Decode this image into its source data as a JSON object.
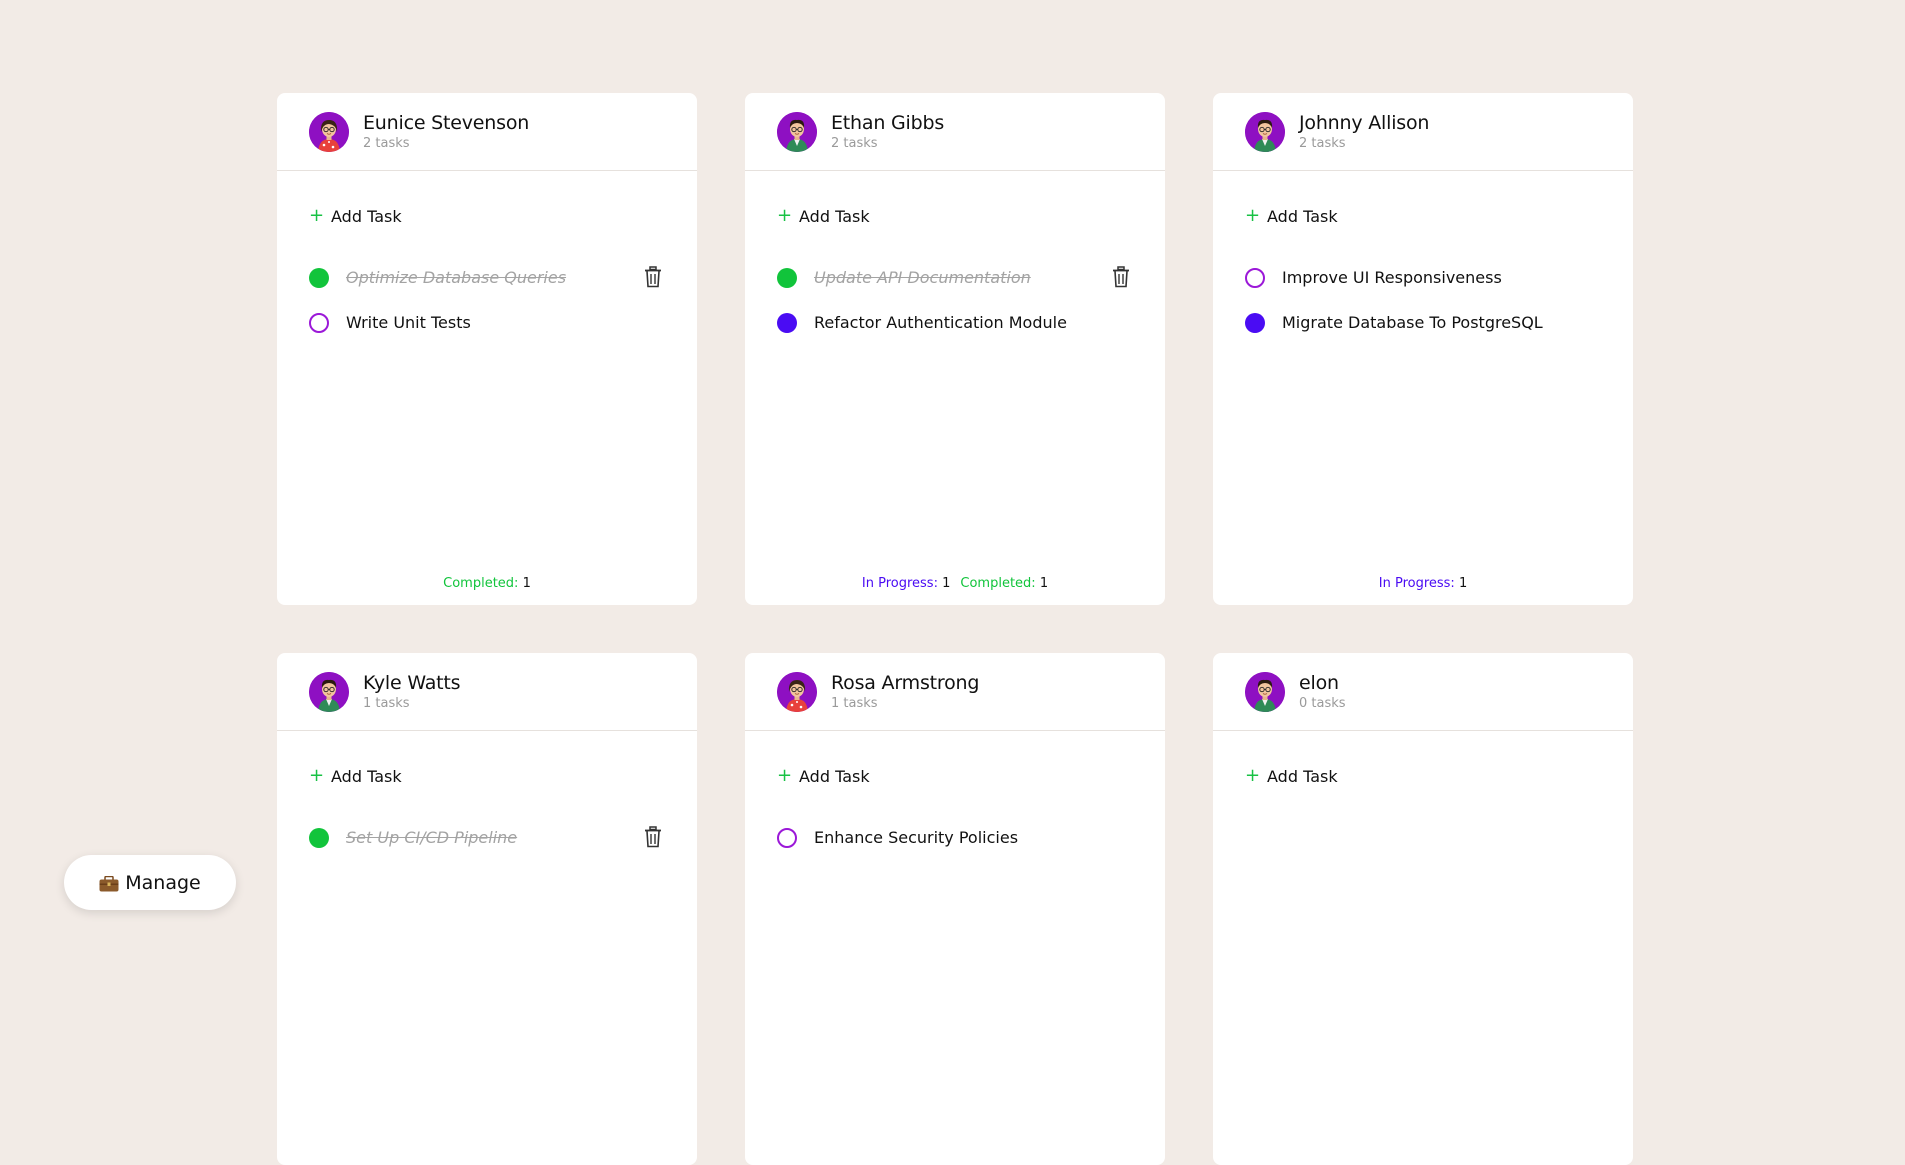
{
  "colors": {
    "background": "#f2ebe6",
    "completed": "#11c43b",
    "in_progress": "#4a0cf3",
    "todo_ring": "#9b18d8",
    "avatar_bg": "#8e10c2",
    "add_plus": "#18c244"
  },
  "add_task_label": "Add Task",
  "plus_symbol": "+",
  "manage_button": {
    "label": "Manage",
    "icon": "briefcase-icon"
  },
  "columns": [
    {
      "name": "Eunice Stevenson",
      "task_count": "2 tasks",
      "avatar": "female-avatar",
      "tasks": [
        {
          "title": "Optimize Database Queries",
          "status": "completed"
        },
        {
          "title": "Write Unit Tests",
          "status": "todo"
        }
      ],
      "footer": [
        {
          "label": "Completed:",
          "value": "1",
          "kind": "completed"
        }
      ]
    },
    {
      "name": "Ethan Gibbs",
      "task_count": "2 tasks",
      "avatar": "male-avatar",
      "tasks": [
        {
          "title": "Update API Documentation",
          "status": "completed"
        },
        {
          "title": "Refactor Authentication Module",
          "status": "progress"
        }
      ],
      "footer": [
        {
          "label": "In Progress:",
          "value": "1",
          "kind": "progress"
        },
        {
          "label": "Completed:",
          "value": "1",
          "kind": "completed"
        }
      ]
    },
    {
      "name": "Johnny Allison",
      "task_count": "2 tasks",
      "avatar": "male-avatar",
      "tasks": [
        {
          "title": "Improve UI Responsiveness",
          "status": "todo"
        },
        {
          "title": "Migrate Database To PostgreSQL",
          "status": "progress"
        }
      ],
      "footer": [
        {
          "label": "In Progress:",
          "value": "1",
          "kind": "progress"
        }
      ]
    },
    {
      "name": "Kyle Watts",
      "task_count": "1 tasks",
      "avatar": "male-avatar",
      "tasks": [
        {
          "title": "Set Up CI/CD Pipeline",
          "status": "completed"
        }
      ],
      "footer": []
    },
    {
      "name": "Rosa Armstrong",
      "task_count": "1 tasks",
      "avatar": "female-avatar",
      "tasks": [
        {
          "title": "Enhance Security Policies",
          "status": "todo"
        }
      ],
      "footer": []
    },
    {
      "name": "elon",
      "task_count": "0 tasks",
      "avatar": "male-avatar",
      "tasks": [],
      "footer": []
    }
  ]
}
